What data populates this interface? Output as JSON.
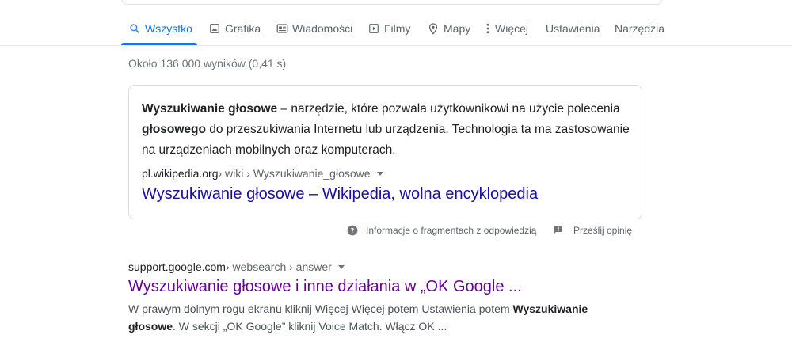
{
  "tabs": [
    {
      "label": "Wszystko",
      "icon": "search-icon"
    },
    {
      "label": "Grafika",
      "icon": "image-icon"
    },
    {
      "label": "Wiadomości",
      "icon": "news-icon"
    },
    {
      "label": "Filmy",
      "icon": "video-icon"
    },
    {
      "label": "Mapy",
      "icon": "map-pin-icon"
    },
    {
      "label": "Więcej",
      "icon": "more-vert-icon"
    },
    {
      "label": "Ustawienia"
    },
    {
      "label": "Narzędzia"
    }
  ],
  "active_tab": "Wszystko",
  "stats": "Około 136 000 wyników (0,41 s)",
  "featured_snippet": {
    "text_parts": {
      "b1": "Wyszukiwanie głosowe",
      "t1": " – narzędzie, które pozwala użytkownikowi na użycie polecenia ",
      "b2": "głosowego",
      "t2": " do przeszukiwania Internetu lub urządzenia. Technologia ta ma zastosowanie na urządzeniach mobilnych oraz komputerach."
    },
    "cite_domain": "pl.wikipedia.org",
    "cite_path": " › wiki › Wyszukiwanie_głosowe",
    "title": "Wyszukiwanie głosowe – Wikipedia, wolna encyklopedia"
  },
  "feedback": {
    "about_label": "Informacje o fragmentach z odpowiedzią",
    "send_label": "Prześlij opinię"
  },
  "result": {
    "cite_domain": "support.google.com",
    "cite_path": " › websearch › answer",
    "title": "Wyszukiwanie głosowe i inne działania w „OK Google ...",
    "desc_parts": {
      "t1": "W prawym dolnym rogu ekranu kliknij Więcej Więcej potem Ustawienia potem ",
      "b1": "Wyszukiwanie głosowe",
      "t2": ". W sekcji „OK Google” kliknij Voice Match. Włącz OK ..."
    }
  },
  "colors": {
    "accent": "#1a73e8",
    "link": "#1a0dab",
    "visited_link": "#660099",
    "muted": "#5f6368"
  }
}
